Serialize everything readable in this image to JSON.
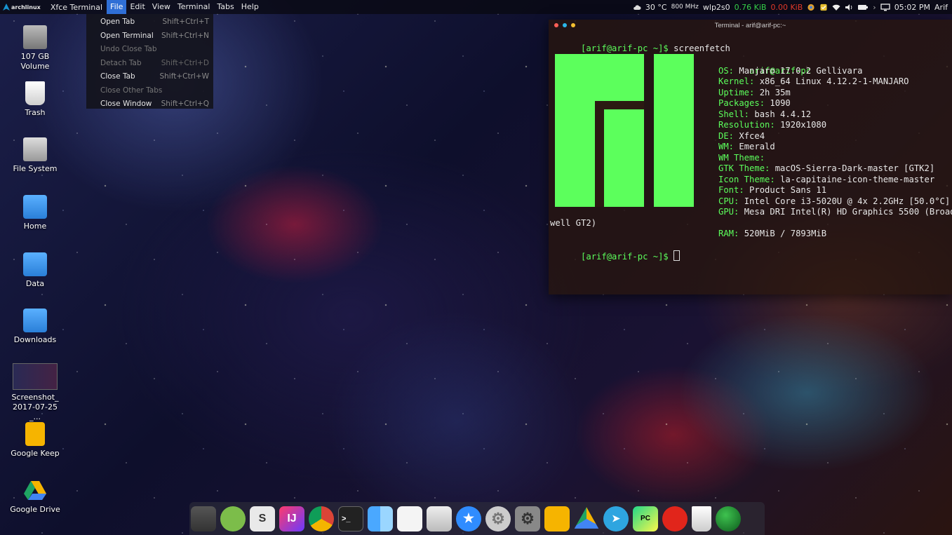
{
  "top_panel": {
    "distro_label": "archlinux",
    "app_title": "Xfce Terminal",
    "menus": [
      "File",
      "Edit",
      "View",
      "Terminal",
      "Tabs",
      "Help"
    ],
    "active_menu": "File",
    "tray": {
      "temperature": "30 °C",
      "cpu_freq": "800 MHz",
      "net_iface": "wlp2s0",
      "net_down": "0.76 KiB",
      "net_up": "0.00 KiB",
      "clock": "05:02 PM",
      "user": "Arif"
    }
  },
  "file_menu": {
    "items": [
      {
        "label": "Open Tab",
        "shortcut": "Shift+Ctrl+T",
        "enabled": true
      },
      {
        "label": "Open Terminal",
        "shortcut": "Shift+Ctrl+N",
        "enabled": true
      },
      {
        "label": "Undo Close Tab",
        "shortcut": "",
        "enabled": false
      },
      {
        "label": "Detach Tab",
        "shortcut": "Shift+Ctrl+D",
        "enabled": false
      },
      {
        "label": "Close Tab",
        "shortcut": "Shift+Ctrl+W",
        "enabled": true
      },
      {
        "label": "Close Other Tabs",
        "shortcut": "",
        "enabled": false
      },
      {
        "label": "Close Window",
        "shortcut": "Shift+Ctrl+Q",
        "enabled": true
      }
    ]
  },
  "desktop_icons": [
    {
      "label": "107 GB Volume",
      "icon": "drive-icon"
    },
    {
      "label": "Trash",
      "icon": "trash-icon"
    },
    {
      "label": "File System",
      "icon": "filesystem-icon"
    },
    {
      "label": "Home",
      "icon": "home-folder-icon"
    },
    {
      "label": "Data",
      "icon": "folder-link-icon"
    },
    {
      "label": "Downloads",
      "icon": "folder-link-icon"
    },
    {
      "label": "Screenshot_2017-07-25_...",
      "icon": "image-thumbnail-icon"
    },
    {
      "label": "Google Keep",
      "icon": "google-keep-icon"
    },
    {
      "label": "Google Drive",
      "icon": "google-drive-icon"
    }
  ],
  "terminal": {
    "title": "Terminal - arif@arif-pc:~",
    "prompt": "[arif@arif-pc ~]$",
    "command": "screenfetch",
    "user_host": "arif@arif-pc",
    "info": [
      {
        "key": "OS:",
        "value": "Manjaro 17.0.2 Gellivara"
      },
      {
        "key": "Kernel:",
        "value": "x86_64 Linux 4.12.2-1-MANJARO"
      },
      {
        "key": "Uptime:",
        "value": "2h 35m"
      },
      {
        "key": "Packages:",
        "value": "1090"
      },
      {
        "key": "Shell:",
        "value": "bash 4.4.12"
      },
      {
        "key": "Resolution:",
        "value": "1920x1080"
      },
      {
        "key": "DE:",
        "value": "Xfce4"
      },
      {
        "key": "WM:",
        "value": "Emerald"
      },
      {
        "key": "WM Theme:",
        "value": ""
      },
      {
        "key": "GTK Theme:",
        "value": "macOS-Sierra-Dark-master [GTK2]"
      },
      {
        "key": "Icon Theme:",
        "value": "la-capitaine-icon-theme-master"
      },
      {
        "key": "Font:",
        "value": "Product Sans 11"
      },
      {
        "key": "CPU:",
        "value": "Intel Core i3-5020U @ 4x 2.2GHz [50.0°C]"
      },
      {
        "key": "GPU:",
        "value": "Mesa DRI Intel(R) HD Graphics 5500 (Broad"
      }
    ],
    "wrap_line": "well GT2)",
    "ram": {
      "key": "RAM:",
      "value": "520MiB / 7893MiB"
    }
  },
  "dock": {
    "items": [
      "sublime-icon",
      "android-studio-icon",
      "scratch-s-icon",
      "intellij-idea-icon",
      "chrome-icon",
      "terminal-icon",
      "finder-icon",
      "text-editor-icon",
      "photos-icon",
      "star-app-icon",
      "settings-gear-icon",
      "system-prefs-icon",
      "google-keep-icon",
      "google-drive-icon",
      "telegram-icon",
      "pycharm-icon",
      "pdf-reader-icon",
      "trash-icon",
      "green-orb-icon"
    ]
  },
  "colors": {
    "terminal_green": "#5cff5c",
    "menu_active": "#2f6fd6",
    "net_down": "#36d14a",
    "net_up": "#e23a2a"
  }
}
